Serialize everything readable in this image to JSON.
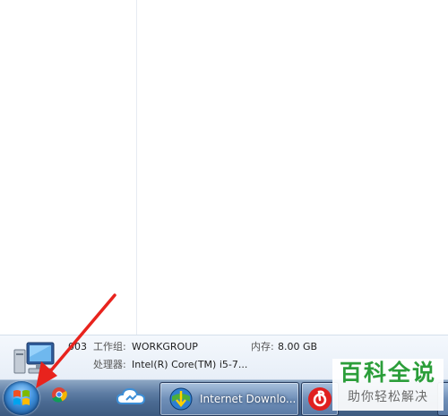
{
  "details": {
    "computer_name": "003",
    "workgroup_label": "工作组:",
    "workgroup_value": "WORKGROUP",
    "memory_label": "内存:",
    "memory_value": "8.00 GB",
    "processor_label": "处理器:",
    "processor_value": "Intel(R) Core(TM) i5-7..."
  },
  "taskbar": {
    "idm_label": "Internet Downlo...",
    "icons": [
      "windows-start-orb",
      "chrome-icon",
      "cloud-icon",
      "idm-icon",
      "netease-music-icon"
    ]
  },
  "watermark": {
    "title": "百科全说",
    "subtitle": "助你轻松解决"
  },
  "colors": {
    "arrow": "#e8231d",
    "watermark_green": "#2c9e3a",
    "taskbar": "#4b6b93"
  }
}
